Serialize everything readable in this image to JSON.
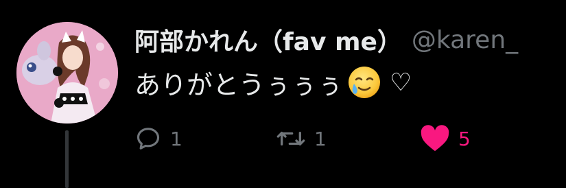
{
  "tweet": {
    "display_name": "阿部かれん（fav me）",
    "handle": "@karen_",
    "text": "ありがとうぅぅぅ",
    "emoji": "smiling-face-with-tear",
    "trailing_symbol": "♡",
    "avatar": "profile-photo"
  },
  "actions": {
    "reply": {
      "icon": "reply-bubble-icon",
      "count": "1"
    },
    "retweet": {
      "icon": "retweet-arrows-icon",
      "count": "1"
    },
    "like": {
      "icon": "heart-filled-icon",
      "count": "5",
      "color": "#f91880",
      "liked": true
    }
  },
  "colors": {
    "background": "#000000",
    "primary_text": "#e7e9ea",
    "secondary_text": "#71767b",
    "like_pink": "#f91880",
    "thread_line": "#333639"
  }
}
